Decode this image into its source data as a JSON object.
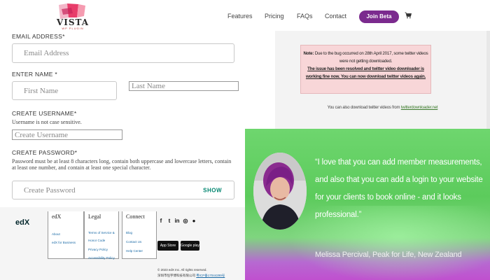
{
  "nav": {
    "logo_text": "VISTA",
    "logo_sub": "WP PLUGIN",
    "links": [
      "Features",
      "Pricing",
      "FAQs",
      "Contact"
    ],
    "cta": "Join Beta",
    "cart_icon": "cart-icon"
  },
  "form": {
    "email_label": "EMAIL ADDRESS*",
    "email_placeholder": "Email Address",
    "name_label": "ENTER NAME *",
    "first_name_placeholder": "First Name",
    "last_name_placeholder": "Last Name",
    "username_label": "CREATE USERNAME*",
    "username_note": "Username is not case sensitive.",
    "username_placeholder": "Create Username",
    "password_label": "CREATE PASSWORD*",
    "password_note": "Password must be at least 8 characters long, contain both uppercase and lowercase letters, contain at least one number, and contain at least one special character.",
    "password_placeholder": "Create Password",
    "show_label": "SHOW"
  },
  "notice": {
    "note_label": "Note:",
    "note_text": " Due to the bug occurred on 28th April 2017, some twitter videos were not getting downloaded.",
    "resolved_text": "The issue has been resolved and twitter video downloader is working fine now. You can now download twitter videos again.",
    "download_prefix": "You can also download twitter videos from",
    "download_link": "twitterdownloader.net"
  },
  "testimonial": {
    "quote": "“I love that you can add member measurements, and also that you can add a login to your website for your clients to book online - and it looks professional.”",
    "author": "Melissa Percival, Peak for Life, New Zealand"
  },
  "footer": {
    "brand": "edX",
    "col1": {
      "title": "edX",
      "links": [
        "About",
        "edX for Business"
      ]
    },
    "col2": {
      "title": "Legal",
      "links": [
        "Terms of Service &",
        "Honor Code",
        "Privacy Policy",
        "Accessibility Policy"
      ]
    },
    "col3": {
      "title": "Connect",
      "links": [
        "Blog",
        "Contact Us",
        "Help Center"
      ]
    },
    "social_icons": [
      "facebook-icon",
      "twitter-icon",
      "linkedin-icon",
      "instagram-icon",
      "reddit-icon"
    ],
    "app_store": "App Store",
    "google_play": "Google play",
    "copyright": "© 2023 edX Inc. All rights reserved.",
    "icp_prefix": "深圳市恒宇博科技有限公司",
    "icp_link": "粤ICP备17044299号"
  },
  "colors": {
    "brand_purple": "#7b2a8e",
    "show_green": "#00856f",
    "notice_pink": "#f8d6d8",
    "testimonial_green": "#6ed66e"
  }
}
